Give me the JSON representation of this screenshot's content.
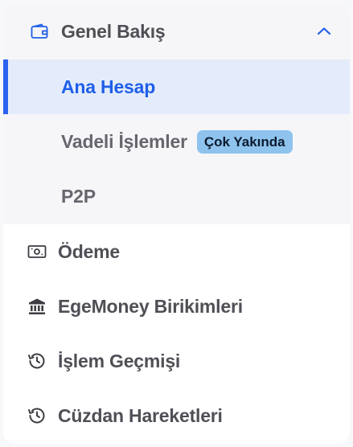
{
  "menu": {
    "group": {
      "title": "Genel Bakış",
      "icon": "wallet-icon",
      "expanded": true,
      "items": [
        {
          "label": "Ana Hesap",
          "active": true
        },
        {
          "label": "Vadeli İşlemler",
          "badge": "Çok Yakında"
        },
        {
          "label": "P2P"
        }
      ]
    },
    "items": [
      {
        "label": "Ödeme",
        "icon": "banknote-icon"
      },
      {
        "label": "EgeMoney Birikimleri",
        "icon": "bank-icon"
      },
      {
        "label": "İşlem Geçmişi",
        "icon": "history-icon"
      },
      {
        "label": "Cüzdan Hareketleri",
        "icon": "history-icon"
      }
    ]
  },
  "colors": {
    "accent": "#2b62f0",
    "active_bg": "#e4ecfb",
    "badge_bg": "#8ec3ee",
    "group_bg": "#f6f6f8"
  }
}
